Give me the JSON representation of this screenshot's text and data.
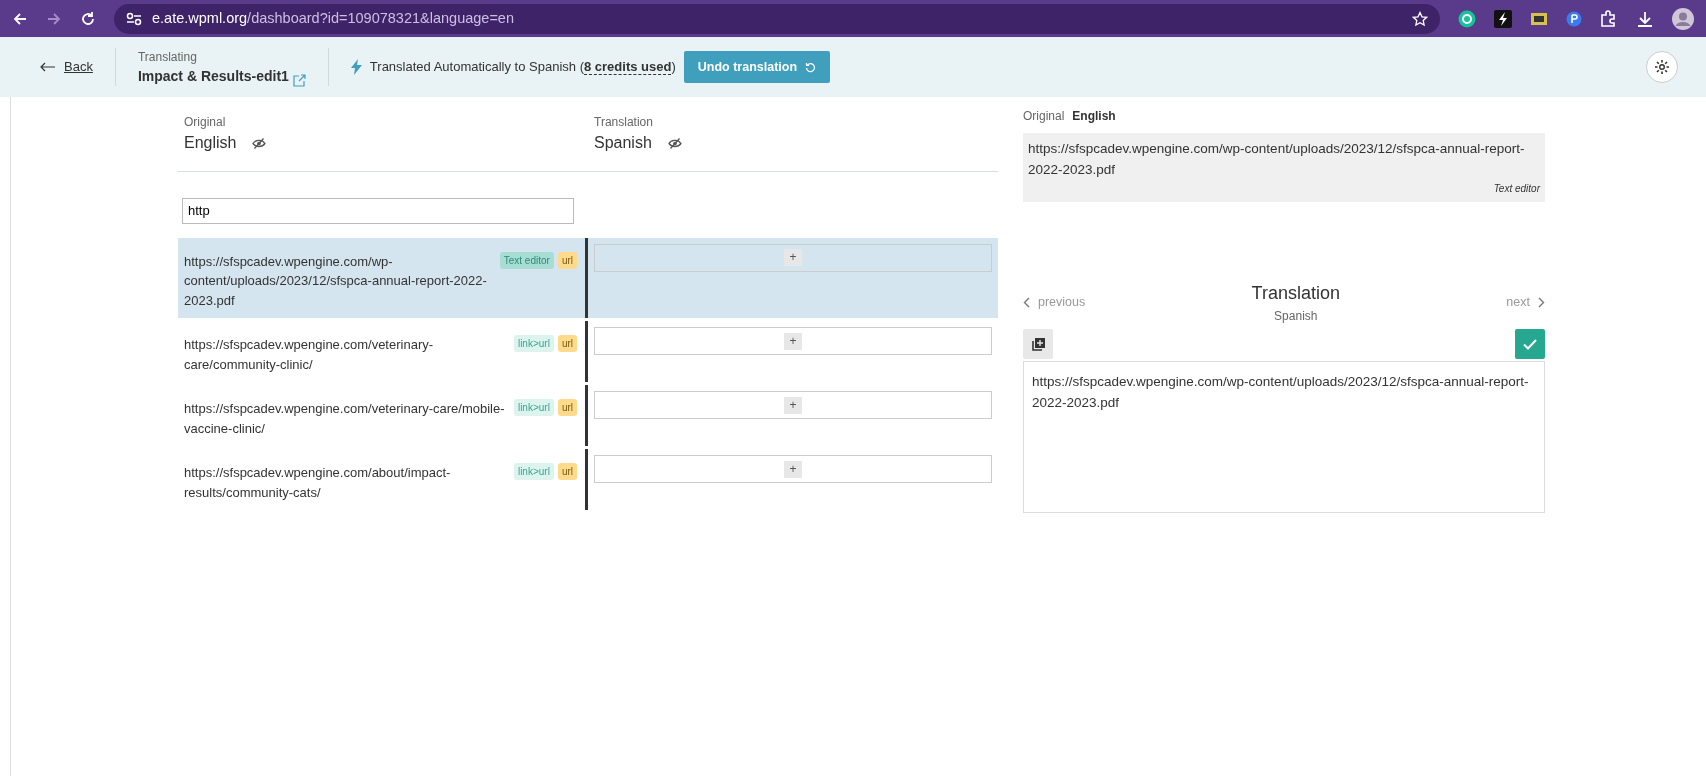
{
  "browser": {
    "url_host": "e.ate.wpml.org",
    "url_path": "/dashboard?id=109078321&language=en"
  },
  "header": {
    "back": "Back",
    "translating_label": "Translating",
    "document_title": "Impact & Results-edit1",
    "status_prefix": "Translated Automatically to Spanish (",
    "credits": "8 credits used",
    "status_suffix": ")",
    "undo_button": "Undo translation"
  },
  "columns": [
    {
      "caption": "Original",
      "language": "English"
    },
    {
      "caption": "Translation",
      "language": "Spanish"
    }
  ],
  "filter": {
    "value": "http"
  },
  "rows": [
    {
      "source": "https://sfspcadev.wpengine.com/wp-content/uploads/2023/12/sfspca-annual-report-2022-2023.pdf",
      "selected": true,
      "tags": [
        {
          "label": "Text editor",
          "kind": "element"
        },
        {
          "label": "url",
          "kind": "type"
        }
      ]
    },
    {
      "source": "https://sfspcadev.wpengine.com/veterinary-care/community-clinic/",
      "selected": false,
      "tags": [
        {
          "label": "link>url",
          "kind": "link"
        },
        {
          "label": "url",
          "kind": "type"
        }
      ]
    },
    {
      "source": "https://sfspcadev.wpengine.com/veterinary-care/mobile-vaccine-clinic/",
      "selected": false,
      "tags": [
        {
          "label": "link>url",
          "kind": "link"
        },
        {
          "label": "url",
          "kind": "type"
        }
      ]
    },
    {
      "source": "https://sfspcadev.wpengine.com/about/impact-results/community-cats/",
      "selected": false,
      "tags": [
        {
          "label": "link>url",
          "kind": "link"
        },
        {
          "label": "url",
          "kind": "type"
        }
      ]
    }
  ],
  "add_button": "+",
  "panel": {
    "original_caption": "Original",
    "original_language": "English",
    "original_text": "https://sfspcadev.wpengine.com/wp-content/uploads/2023/12/sfspca-annual-report-2022-2023.pdf",
    "original_context": "Text editor",
    "previous": "previous",
    "next": "next",
    "title": "Translation",
    "language": "Spanish",
    "translation_text": "https://sfspcadev.wpengine.com/wp-content/uploads/2023/12/sfspca-annual-report-2022-2023.pdf"
  }
}
